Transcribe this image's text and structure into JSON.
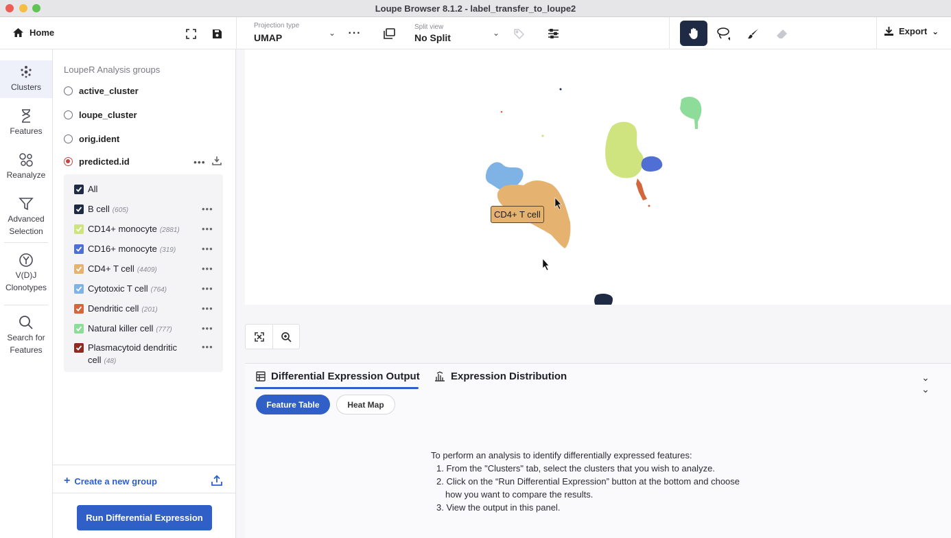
{
  "window": {
    "title": "Loupe Browser 8.1.2 - label_transfer_to_loupe2"
  },
  "toolbar": {
    "home_label": "Home",
    "projection_label": "Projection type",
    "projection_value": "UMAP",
    "split_label": "Split view",
    "split_value": "No Split",
    "export_label": "Export"
  },
  "rail": {
    "items": [
      {
        "label": "Clusters"
      },
      {
        "label": "Features"
      },
      {
        "label": "Reanalyze"
      },
      {
        "label": "Advanced Selection"
      },
      {
        "label": "V(D)J Clonotypes"
      },
      {
        "label": "Search for Features"
      }
    ]
  },
  "groups": {
    "title": "LoupeR Analysis groups",
    "items": [
      {
        "label": "active_cluster",
        "selected": false
      },
      {
        "label": "loupe_cluster",
        "selected": false
      },
      {
        "label": "orig.ident",
        "selected": false
      },
      {
        "label": "predicted.id",
        "selected": true
      }
    ],
    "all_label": "All",
    "categories": [
      {
        "label": "B cell",
        "count": "(605)",
        "color": "#1f2a44"
      },
      {
        "label": "CD14+ monocyte",
        "count": "(2881)",
        "color": "#cfe37f"
      },
      {
        "label": "CD16+ monocyte",
        "count": "(319)",
        "color": "#4f6fd4"
      },
      {
        "label": "CD4+ T cell",
        "count": "(4409)",
        "color": "#e5b36f"
      },
      {
        "label": "Cytotoxic T cell",
        "count": "(764)",
        "color": "#7fb3e6"
      },
      {
        "label": "Dendritic cell",
        "count": "(201)",
        "color": "#d2663d"
      },
      {
        "label": "Natural killer cell",
        "count": "(777)",
        "color": "#8ddc9a"
      },
      {
        "label": "Plasmacytoid dendritic",
        "label2": "cell",
        "count": "(48)",
        "color": "#8e2a22"
      }
    ],
    "create_label": "Create a new group",
    "run_label": "Run Differential Expression"
  },
  "plot": {
    "tooltip": "CD4+ T cell"
  },
  "bottom": {
    "tab1": "Differential Expression Output",
    "tab2": "Expression Distribution",
    "pill1": "Feature Table",
    "pill2": "Heat Map",
    "intro": "To perform an analysis to identify differentially expressed features:",
    "step1": "1. From the \"Clusters\" tab, select the clusters that you wish to analyze.",
    "step2a": "2. Click on the “Run Differential Expression” button at the bottom and choose",
    "step2b": "how you want to compare the results.",
    "step3": "3. View the output in this panel."
  }
}
